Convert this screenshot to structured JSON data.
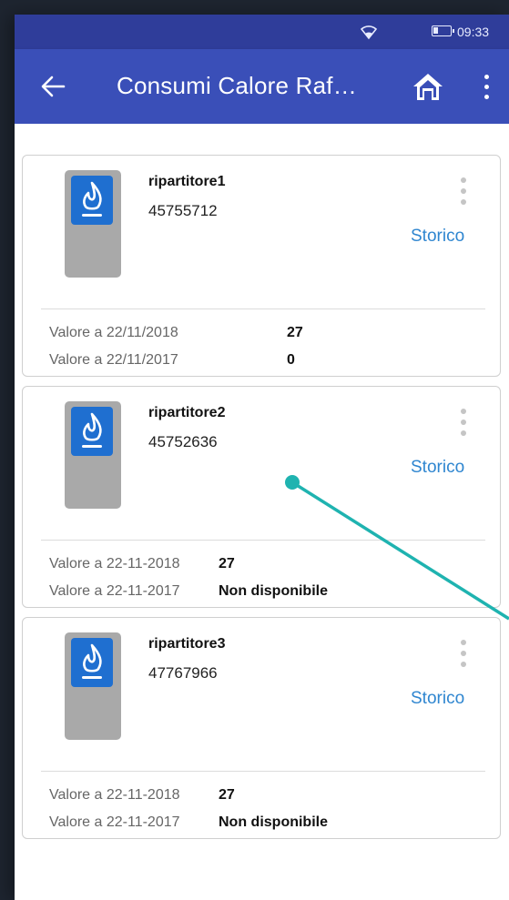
{
  "status_bar": {
    "time": "09:33",
    "wifi_icon": "wifi-icon",
    "battery_icon": "battery-icon"
  },
  "app_bar": {
    "title": "Consumi Calore Raf…",
    "back_icon": "arrow-left-icon",
    "home_icon": "home-icon",
    "menu_icon": "more-vert-icon",
    "color": "#3a4fb8"
  },
  "cards": [
    {
      "name": "ripartitore1",
      "serial": "45755712",
      "action": "Storico",
      "rows": [
        {
          "label": "Valore a 22/11/2018",
          "value": "27"
        },
        {
          "label": "Valore a 22/11/2017",
          "value": "0"
        }
      ]
    },
    {
      "name": "ripartitore2",
      "serial": "45752636",
      "action": "Storico",
      "rows": [
        {
          "label": "Valore a 22-11-2018",
          "value": "27"
        },
        {
          "label": "Valore a 22-11-2017",
          "value": "Non disponibile"
        }
      ]
    },
    {
      "name": "ripartitore3",
      "serial": "47767966",
      "action": "Storico",
      "rows": [
        {
          "label": "Valore a 22-11-2018",
          "value": "27"
        },
        {
          "label": "Valore a 22-11-2017",
          "value": "Non disponibile"
        }
      ]
    }
  ],
  "colors": {
    "link": "#2f86d0",
    "meter_badge": "#1f6fd0",
    "annotation": "#1fb3b0"
  }
}
